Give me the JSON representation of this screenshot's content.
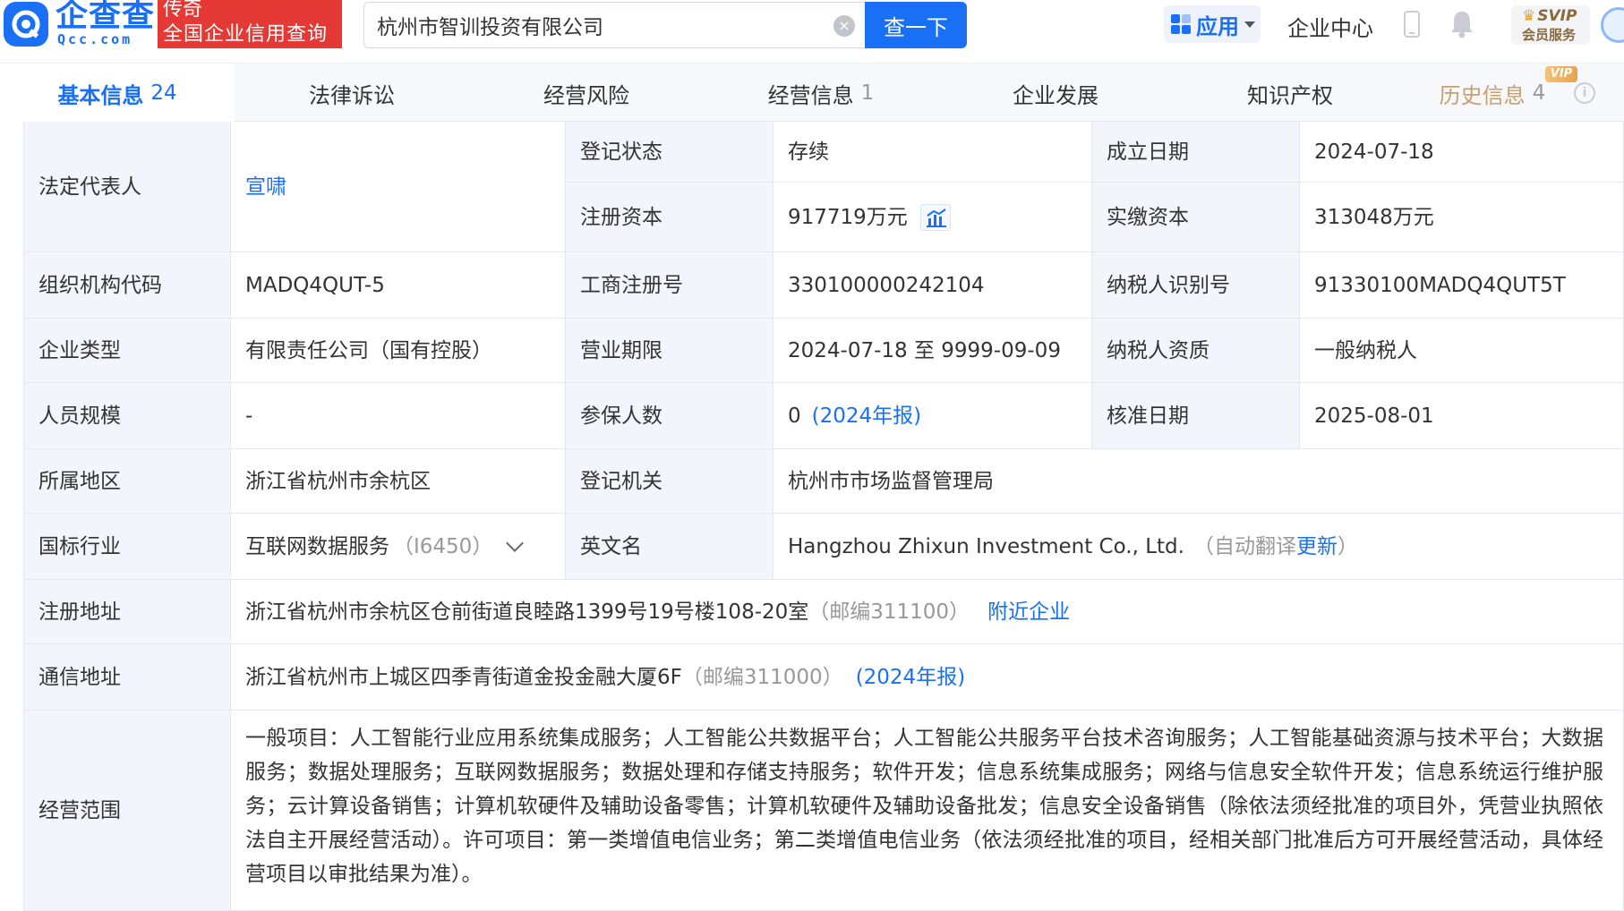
{
  "header": {
    "logo_cn": "企查查",
    "logo_en": "Qcc.com",
    "promo_line1": "传奇",
    "promo_line2": "全国企业信用查询",
    "search_value": "杭州市智训投资有限公司",
    "search_button": "查一下",
    "apps_label": "应用",
    "corp_center": "企业中心",
    "svip_line1": "SVIP",
    "svip_line2": "会员服务",
    "accent_color": "#1a70f5"
  },
  "tabs": [
    {
      "label": "基本信息",
      "count": "24"
    },
    {
      "label": "法律诉讼",
      "count": ""
    },
    {
      "label": "经营风险",
      "count": ""
    },
    {
      "label": "经营信息",
      "count": "1"
    },
    {
      "label": "企业发展",
      "count": ""
    },
    {
      "label": "知识产权",
      "count": ""
    },
    {
      "label": "历史信息",
      "count": "4"
    }
  ],
  "vip_badge": "VIP",
  "info": {
    "legal_rep_label": "法定代表人",
    "legal_rep": "宣啸",
    "reg_status_label": "登记状态",
    "reg_status": "存续",
    "found_date_label": "成立日期",
    "found_date": "2024-07-18",
    "reg_capital_label": "注册资本",
    "reg_capital": "917719万元",
    "paid_capital_label": "实缴资本",
    "paid_capital": "313048万元",
    "org_code_label": "组织机构代码",
    "org_code": "MADQ4QUT-5",
    "biz_reg_no_label": "工商注册号",
    "biz_reg_no": "330100000242104",
    "taxpayer_id_label": "纳税人识别号",
    "taxpayer_id": "91330100MADQ4QUT5T",
    "company_type_label": "企业类型",
    "company_type": "有限责任公司（国有控股）",
    "biz_term_label": "营业期限",
    "biz_term": "2024-07-18 至 9999-09-09",
    "taxpayer_qual_label": "纳税人资质",
    "taxpayer_qual": "一般纳税人",
    "staff_size_label": "人员规模",
    "staff_size": "-",
    "insured_label": "参保人数",
    "insured": "0",
    "insured_report": "(2024年报)",
    "approve_date_label": "核准日期",
    "approve_date": "2025-08-01",
    "region_label": "所属地区",
    "region": "浙江省杭州市余杭区",
    "reg_authority_label": "登记机关",
    "reg_authority": "杭州市市场监督管理局",
    "industry_label": "国标行业",
    "industry": "互联网数据服务",
    "industry_code": "（I6450）",
    "english_name_label": "英文名",
    "english_name": "Hangzhou Zhixun Investment Co., Ltd.",
    "auto_translate_prefix": "（自动翻译",
    "auto_translate_update": "更新",
    "auto_translate_suffix": "）",
    "reg_address_label": "注册地址",
    "reg_address": "浙江省杭州市余杭区仓前街道良睦路1399号19号楼108-20室",
    "reg_address_zip": "（邮编311100）",
    "nearby_link": "附近企业",
    "mail_address_label": "通信地址",
    "mail_address": "浙江省杭州市上城区四季青街道金投金融大厦6F",
    "mail_address_zip": "（邮编311000）",
    "mail_report": "(2024年报)",
    "scope_label": "经营范围",
    "scope": "一般项目：人工智能行业应用系统集成服务；人工智能公共数据平台；人工智能公共服务平台技术咨询服务；人工智能基础资源与技术平台；大数据服务；数据处理服务；互联网数据服务；数据处理和存储支持服务；软件开发；信息系统集成服务；网络与信息安全软件开发；信息系统运行维护服务；云计算设备销售；计算机软硬件及辅助设备零售；计算机软硬件及辅助设备批发；信息安全设备销售（除依法须经批准的项目外，凭营业执照依法自主开展经营活动）。许可项目：第一类增值电信业务；第二类增值电信业务（依法须经批准的项目，经相关部门批准后方可开展经营活动，具体经营项目以审批结果为准）。"
  }
}
